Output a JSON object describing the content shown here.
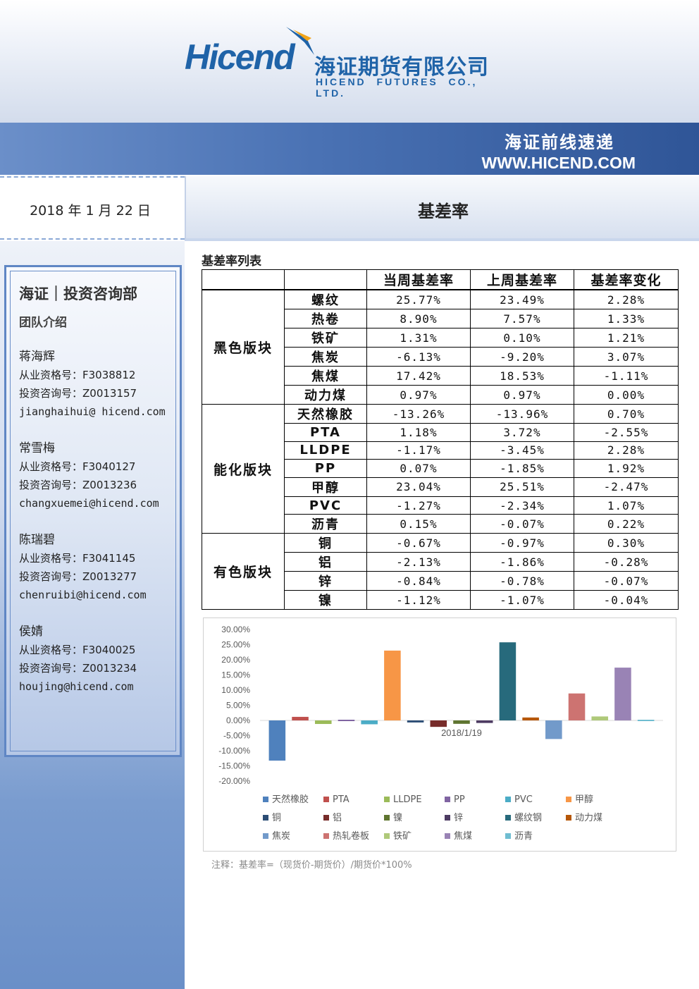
{
  "header": {
    "logo_word": "Hicend",
    "logo_reg": "®",
    "company_cn": "海证期货有限公司",
    "company_en": "HICEND FUTURES CO., LTD.",
    "banner_title": "海证前线速递",
    "website": "WWW.HICEND.COM"
  },
  "date": "2018 年 1 月 22 日",
  "report_title": "基差率",
  "sidebar": {
    "dept": "海证｜投资咨询部",
    "team_intro": "团队介绍",
    "people": [
      {
        "name": "蒋海辉",
        "qual": "从业资格号：F3038812",
        "advice": "投资咨询号：Z0013157",
        "email": "jianghaihui@ hicend.com"
      },
      {
        "name": "常雪梅",
        "qual": "从业资格号：F3040127",
        "advice": "投资咨询号：Z0013236",
        "email": "changxuemei@hicend.com"
      },
      {
        "name": "陈瑞碧",
        "qual": "从业资格号：F3041145",
        "advice": "投资咨询号：Z0013277",
        "email": "chenruibi@hicend.com"
      },
      {
        "name": "侯婧",
        "qual": "从业资格号：F3040025",
        "advice": "投资咨询号：Z0013234",
        "email": "houjing@hicend.com"
      }
    ]
  },
  "table": {
    "caption": "基差率列表",
    "headers": [
      "当周基差率",
      "上周基差率",
      "基差率变化"
    ],
    "groups": [
      {
        "name": "黑色版块",
        "rows": [
          {
            "item": "螺纹",
            "cur": "25.77%",
            "prev": "23.49%",
            "chg": "2.28%"
          },
          {
            "item": "热卷",
            "cur": "8.90%",
            "prev": "7.57%",
            "chg": "1.33%"
          },
          {
            "item": "铁矿",
            "cur": "1.31%",
            "prev": "0.10%",
            "chg": "1.21%"
          },
          {
            "item": "焦炭",
            "cur": "-6.13%",
            "prev": "-9.20%",
            "chg": "3.07%"
          },
          {
            "item": "焦煤",
            "cur": "17.42%",
            "prev": "18.53%",
            "chg": "-1.11%"
          },
          {
            "item": "动力煤",
            "cur": "0.97%",
            "prev": "0.97%",
            "chg": "0.00%"
          }
        ]
      },
      {
        "name": "能化版块",
        "rows": [
          {
            "item": "天然橡胶",
            "cur": "-13.26%",
            "prev": "-13.96%",
            "chg": "0.70%"
          },
          {
            "item": "PTA",
            "cur": "1.18%",
            "prev": "3.72%",
            "chg": "-2.55%"
          },
          {
            "item": "LLDPE",
            "cur": "-1.17%",
            "prev": "-3.45%",
            "chg": "2.28%"
          },
          {
            "item": "PP",
            "cur": "0.07%",
            "prev": "-1.85%",
            "chg": "1.92%"
          },
          {
            "item": "甲醇",
            "cur": "23.04%",
            "prev": "25.51%",
            "chg": "-2.47%"
          },
          {
            "item": "PVC",
            "cur": "-1.27%",
            "prev": "-2.34%",
            "chg": "1.07%"
          },
          {
            "item": "沥青",
            "cur": "0.15%",
            "prev": "-0.07%",
            "chg": "0.22%"
          }
        ]
      },
      {
        "name": "有色版块",
        "rows": [
          {
            "item": "铜",
            "cur": "-0.67%",
            "prev": "-0.97%",
            "chg": "0.30%"
          },
          {
            "item": "铝",
            "cur": "-2.13%",
            "prev": "-1.86%",
            "chg": "-0.28%"
          },
          {
            "item": "锌",
            "cur": "-0.84%",
            "prev": "-0.78%",
            "chg": "-0.07%"
          },
          {
            "item": "镍",
            "cur": "-1.12%",
            "prev": "-1.07%",
            "chg": "-0.04%"
          }
        ]
      }
    ]
  },
  "chart_data": {
    "type": "bar",
    "categories": [
      "2018/1/19"
    ],
    "ylim": [
      -20,
      30
    ],
    "yticks": [
      "30.00%",
      "25.00%",
      "20.00%",
      "15.00%",
      "10.00%",
      "5.00%",
      "0.00%",
      "-5.00%",
      "-10.00%",
      "-15.00%",
      "-20.00%"
    ],
    "ytick_values": [
      30,
      25,
      20,
      15,
      10,
      5,
      0,
      -5,
      -10,
      -15,
      -20
    ],
    "grid": false,
    "legend_position": "bottom",
    "series": [
      {
        "name": "天然橡胶",
        "values": [
          -13.26
        ],
        "color": "#4f81bd"
      },
      {
        "name": "PTA",
        "values": [
          1.18
        ],
        "color": "#c0504d"
      },
      {
        "name": "LLDPE",
        "values": [
          -1.17
        ],
        "color": "#9bbb59"
      },
      {
        "name": "PP",
        "values": [
          0.07
        ],
        "color": "#8064a2"
      },
      {
        "name": "PVC",
        "values": [
          -1.27
        ],
        "color": "#4bacc6"
      },
      {
        "name": "甲醇",
        "values": [
          23.04
        ],
        "color": "#f79646"
      },
      {
        "name": "铜",
        "values": [
          -0.67
        ],
        "color": "#2c4d75"
      },
      {
        "name": "铝",
        "values": [
          -2.13
        ],
        "color": "#772c2a"
      },
      {
        "name": "镍",
        "values": [
          -1.12
        ],
        "color": "#5f7530"
      },
      {
        "name": "锌",
        "values": [
          -0.84
        ],
        "color": "#4d3b62"
      },
      {
        "name": "螺纹钢",
        "values": [
          25.77
        ],
        "color": "#276a7c"
      },
      {
        "name": "动力煤",
        "values": [
          0.97
        ],
        "color": "#b65708"
      },
      {
        "name": "焦炭",
        "values": [
          -6.13
        ],
        "color": "#729aca"
      },
      {
        "name": "热轧卷板",
        "values": [
          8.9
        ],
        "color": "#cd7371"
      },
      {
        "name": "铁矿",
        "values": [
          1.31
        ],
        "color": "#afc97a"
      },
      {
        "name": "焦煤",
        "values": [
          17.42
        ],
        "color": "#9983b5"
      },
      {
        "name": "沥青",
        "values": [
          0.15
        ],
        "color": "#6fbdd1"
      }
    ]
  },
  "note": "注释：基差率=（现货价-期货价）/期货价*100%"
}
